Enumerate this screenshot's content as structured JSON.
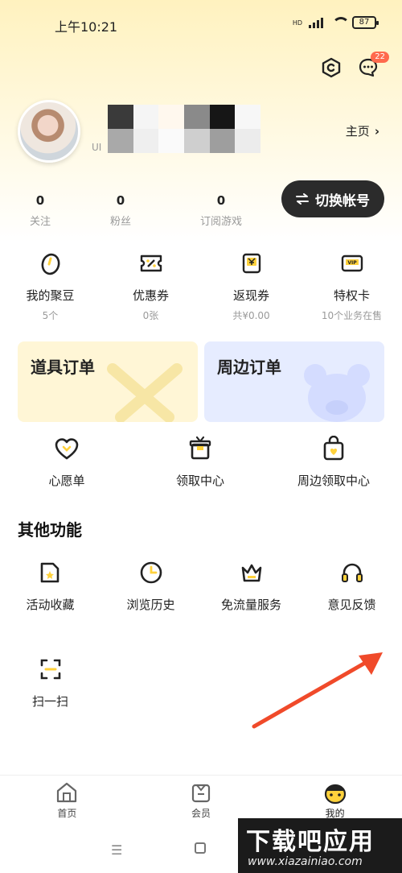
{
  "status_bar": {
    "time": "上午10:21",
    "hd": "HD",
    "battery": "87"
  },
  "header": {
    "message_badge": "22"
  },
  "profile": {
    "uid_prefix": "UI",
    "home_link": "主页",
    "switch_account": "切换帐号"
  },
  "stats": [
    {
      "value": "0",
      "label": "关注"
    },
    {
      "value": "0",
      "label": "粉丝"
    },
    {
      "value": "0",
      "label": "订阅游戏"
    }
  ],
  "wallet": [
    {
      "title": "我的聚豆",
      "sub": "5个",
      "icon": "bean-icon"
    },
    {
      "title": "优惠券",
      "sub": "0张",
      "icon": "coupon-icon"
    },
    {
      "title": "返现券",
      "sub": "共¥0.00",
      "icon": "cashback-icon"
    },
    {
      "title": "特权卡",
      "sub": "10个业务在售",
      "icon": "vip-card-icon"
    }
  ],
  "orders": {
    "props": "道具订单",
    "merch": "周边订单"
  },
  "services": [
    {
      "title": "心愿单",
      "icon": "heart-icon"
    },
    {
      "title": "领取中心",
      "icon": "gift-icon"
    },
    {
      "title": "周边领取中心",
      "icon": "bag-icon"
    }
  ],
  "other_title": "其他功能",
  "other": [
    {
      "title": "活动收藏",
      "icon": "folder-star-icon"
    },
    {
      "title": "浏览历史",
      "icon": "clock-icon"
    },
    {
      "title": "免流量服务",
      "icon": "crown-icon"
    },
    {
      "title": "意见反馈",
      "icon": "headphones-icon"
    }
  ],
  "scan": {
    "title": "扫一扫",
    "icon": "scan-icon"
  },
  "bottom_nav": [
    {
      "label": "首页",
      "icon": "home-icon"
    },
    {
      "label": "会员",
      "icon": "member-icon"
    },
    {
      "label": "我的",
      "icon": "mine-icon"
    }
  ],
  "watermark": {
    "brand": "下载吧应用",
    "url": "www.xiazainiao.com"
  },
  "colors": {
    "accent_yellow": "#ffd23c",
    "dark_button": "#2b2b2b",
    "badge": "#ff6a4d",
    "arrow": "#f04a2a"
  }
}
